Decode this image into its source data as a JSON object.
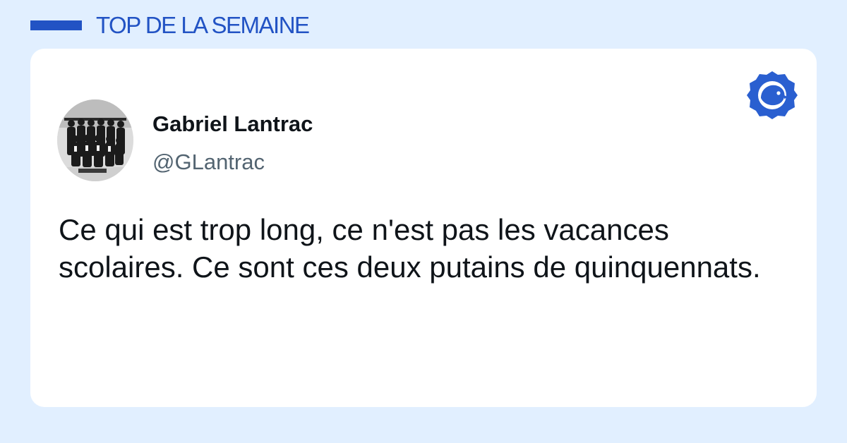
{
  "header": {
    "title": "TOP DE LA SEMAINE"
  },
  "tweet": {
    "author_name": "Gabriel Lantrac",
    "author_handle": "@GLantrac",
    "text": "Ce qui est trop long, ce n'est pas les vacances scolaires. Ce sont ces deux putains de quinquennats."
  },
  "icons": {
    "avatar": "group-photo-avatar",
    "brand": "bird-badge-logo-icon"
  },
  "colors": {
    "background": "#e1efff",
    "accent": "#2253c4",
    "card": "#ffffff",
    "text": "#0f1419",
    "handle": "#536471"
  }
}
